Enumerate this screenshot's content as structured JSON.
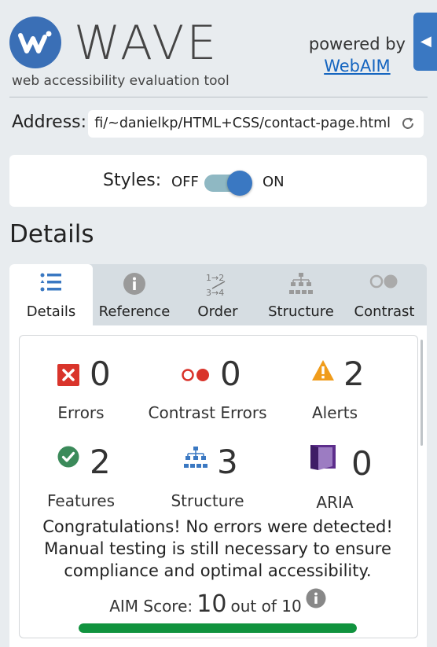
{
  "header": {
    "title": "WAVE",
    "tagline": "web accessibility evaluation tool",
    "powered_by": "powered by",
    "powered_link": "WebAIM",
    "collapse_icon": "triangle-left-icon"
  },
  "address": {
    "label": "Address:",
    "value": "fi/~danielkp/HTML+CSS/contact-page.html",
    "reload_icon": "reload-icon"
  },
  "styles": {
    "label": "Styles:",
    "off": "OFF",
    "on": "ON",
    "enabled": true
  },
  "section_title": "Details",
  "tabs": [
    {
      "label": "Details",
      "icon": "list-icon",
      "active": true
    },
    {
      "label": "Reference",
      "icon": "info-icon",
      "active": false
    },
    {
      "label": "Order",
      "icon": "order-icon",
      "active": false
    },
    {
      "label": "Structure",
      "icon": "structure-icon",
      "active": false
    },
    {
      "label": "Contrast",
      "icon": "contrast-icon",
      "active": false
    }
  ],
  "summary": {
    "errors": {
      "count": "0",
      "label": "Errors",
      "color": "#d9342b"
    },
    "contrast_errors": {
      "count": "0",
      "label": "Contrast Errors",
      "color": "#d9342b"
    },
    "alerts": {
      "count": "2",
      "label": "Alerts",
      "color": "#f09c1b"
    },
    "features": {
      "count": "2",
      "label": "Features",
      "color": "#3b8a5a"
    },
    "structure": {
      "count": "3",
      "label": "Structure",
      "color": "#3a78c2"
    },
    "aria": {
      "count": "0",
      "label": "ARIA",
      "color": "#5d2e8c"
    }
  },
  "congrats": "Congratulations! No errors were detected! Manual testing is still necessary to ensure compliance and optimal accessibility.",
  "aim": {
    "label": "AIM Score:",
    "score": "10",
    "out_of": "out of 10",
    "fraction": 1.0,
    "color": "#10933e"
  }
}
